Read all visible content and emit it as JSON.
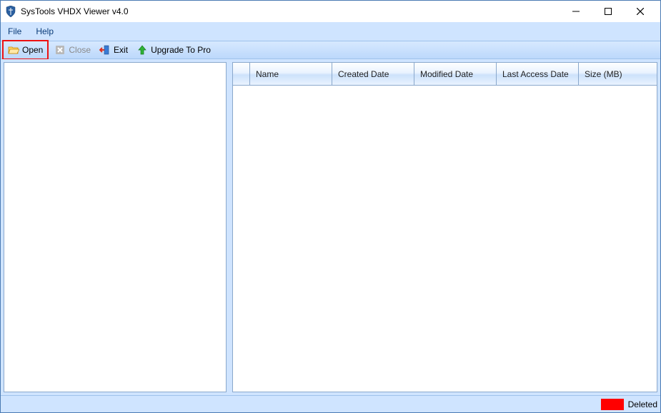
{
  "titlebar": {
    "title": "SysTools VHDX Viewer v4.0"
  },
  "menubar": {
    "file": "File",
    "help": "Help"
  },
  "toolbar": {
    "open": "Open",
    "close": "Close",
    "exit": "Exit",
    "upgrade": "Upgrade To Pro"
  },
  "columns": {
    "checkbox_width": 24,
    "name": "Name",
    "created": "Created Date",
    "modified": "Modified Date",
    "lastaccess": "Last Access Date",
    "size": "Size (MB)"
  },
  "statusbar": {
    "deleted": "Deleted"
  }
}
